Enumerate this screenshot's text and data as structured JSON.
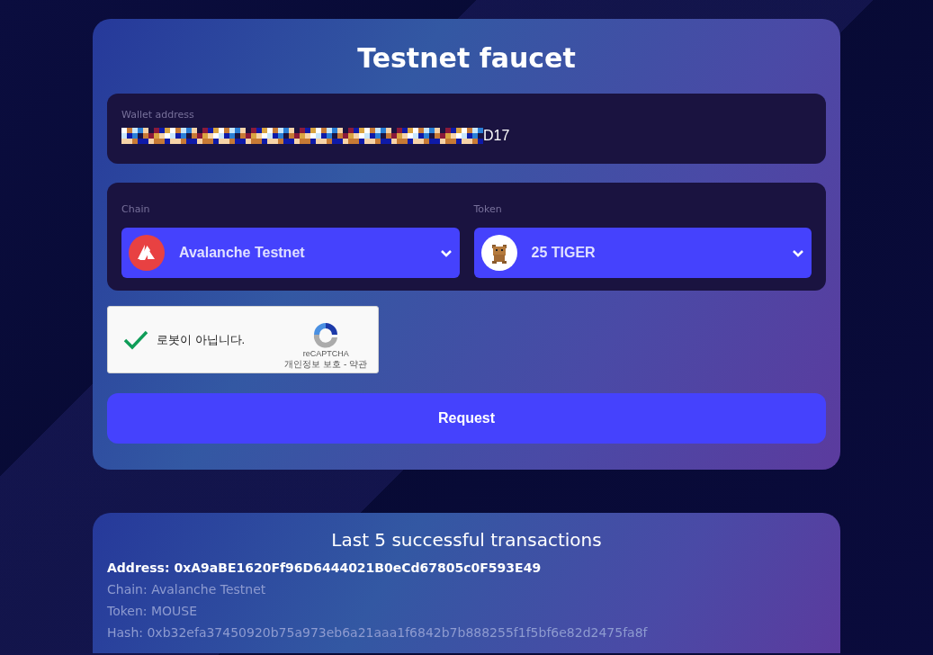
{
  "faucet": {
    "title": "Testnet faucet",
    "wallet": {
      "label": "Wallet address",
      "value": "D17"
    },
    "chain": {
      "label": "Chain",
      "value": "Avalanche Testnet"
    },
    "token": {
      "label": "Token",
      "value": "25 TIGER"
    },
    "captcha": {
      "label": "로봇이 아닙니다.",
      "checked": true,
      "brand": "reCAPTCHA",
      "links": "개인정보 보호 - 약관"
    },
    "button": "Request"
  },
  "transactions": {
    "title": "Last 5 successful transactions",
    "items": [
      {
        "address": "Address: 0xA9aBE1620Ff96D6444021B0eCd67805c0F593E49",
        "chain": "Chain: Avalanche Testnet",
        "token": "Token: MOUSE",
        "hash": "Hash: 0xb32efa37450920b75a973eb6a21aaa1f6842b7b888255f1f5bf6e82d2475fa8f"
      }
    ]
  }
}
